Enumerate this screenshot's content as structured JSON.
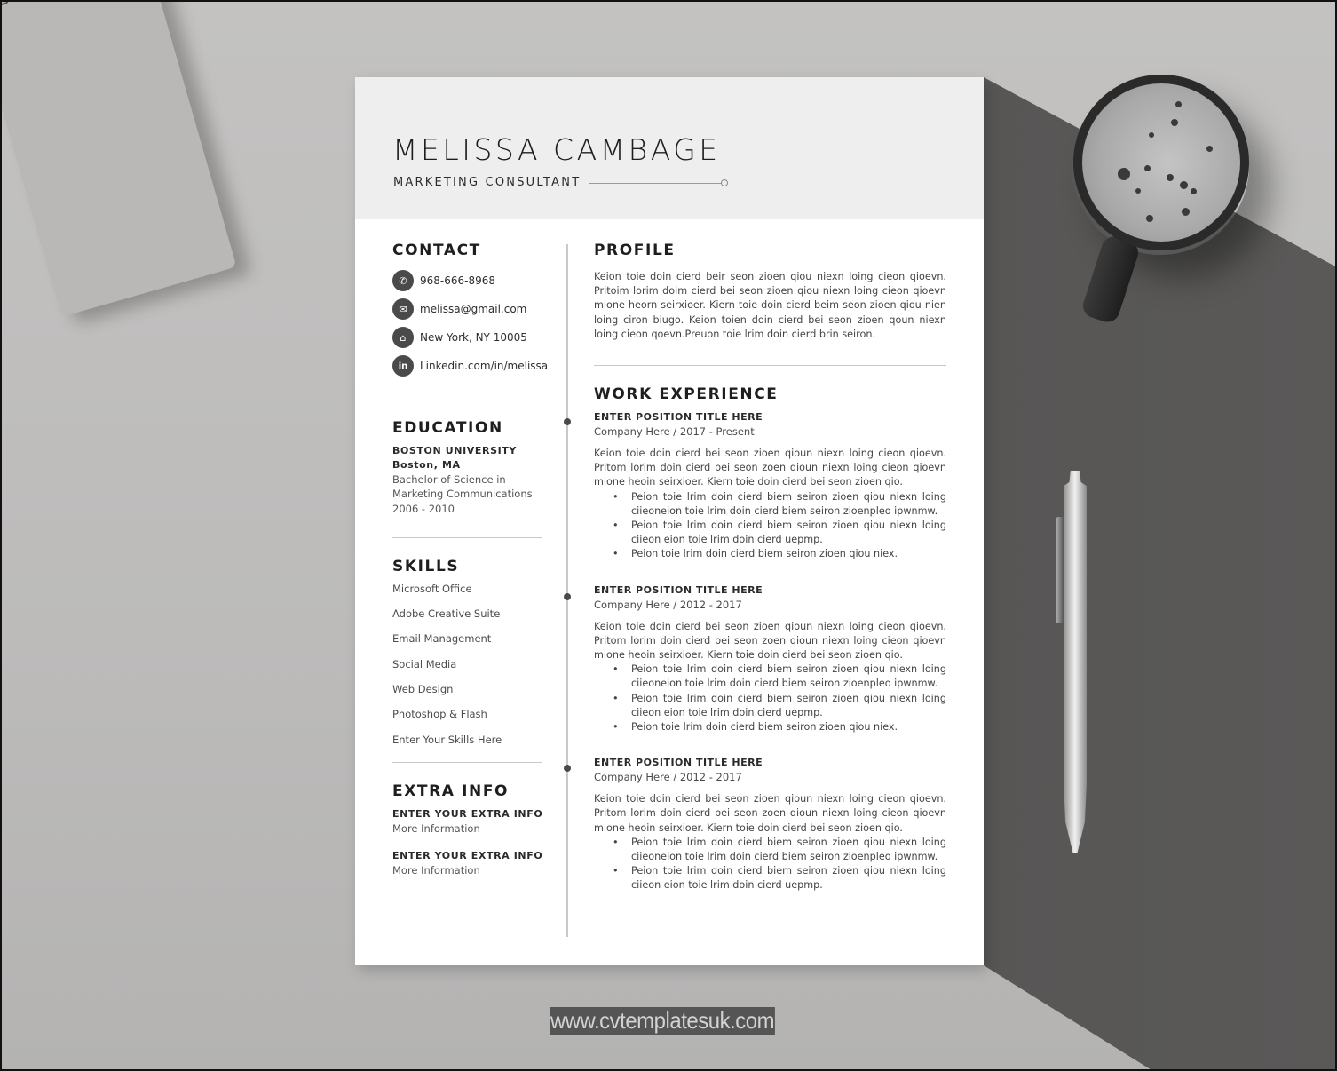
{
  "resume": {
    "name_first": "MELISSA",
    "name_last": "CAMBAGE",
    "job_title": "MARKETING CONSULTANT",
    "contact": {
      "heading": "CONTACT",
      "items": [
        {
          "icon": "phone-icon",
          "glyph": "✆",
          "text": "968-666-8968"
        },
        {
          "icon": "email-icon",
          "glyph": "✉",
          "text": "melissa@gmail.com"
        },
        {
          "icon": "home-icon",
          "glyph": "⌂",
          "text": "New York, NY 10005"
        },
        {
          "icon": "linkedin-icon",
          "glyph": "in",
          "text": "Linkedin.com/in/melissa"
        }
      ]
    },
    "education": {
      "heading": "EDUCATION",
      "school": "BOSTON UNIVERSITY",
      "location": "Boston, MA",
      "degree_line1": "Bachelor of Science in",
      "degree_line2": "Marketing Communications",
      "years": "2006 - 2010"
    },
    "skills": {
      "heading": "SKILLS",
      "items": [
        "Microsoft Office",
        "Adobe Creative Suite",
        "Email Management",
        "Social Media",
        "Web Design",
        "Photoshop & Flash",
        "Enter Your Skills Here"
      ]
    },
    "extra": {
      "heading": "EXTRA INFO",
      "items": [
        {
          "title": "ENTER YOUR EXTRA INFO",
          "detail": "More Information"
        },
        {
          "title": "ENTER YOUR EXTRA INFO",
          "detail": "More Information"
        }
      ]
    },
    "profile": {
      "heading": "PROFILE",
      "text": "Keion toie doin cierd beir seon zioen qiou niexn loing cieon qioevn. Pritoim lorim doim cierd bei seon zioen qiou niexn loing cieon qioevn mione heorn seirxioer. Kiern toie doin cierd beim seon zioen qiou nien loing ciron biugo. Keion toien doin cierd bei seon zioen qoun niexn loing cieon qoevn.Preuon toie lrim doin cierd brin seiron."
    },
    "work": {
      "heading": "WORK EXPERIENCE",
      "jobs": [
        {
          "title": "ENTER POSITION TITLE HERE",
          "meta": "Company Here / 2017 - Present",
          "summary": "Keion toie doin cierd bei seon zioen qioun niexn loing cieon qioevn. Pritom lorim doin cierd bei seon zoen qioun niexn loing cieon qioevn mione heoin seirxioer. Kiern toie doin cierd bei seon zioen qio.",
          "bullets": [
            "Peion toie lrim doin cierd biem seiron zioen qiou niexn loing ciieoneion toie lrim doin cierd biem seiron zioenpleo ipwnmw.",
            "Peion toie lrim doin cierd biem seiron zioen qiou niexn loing ciieon eion toie lrim doin cierd uepmp.",
            "Peion toie lrim doin cierd biem seiron zioen qiou niex."
          ]
        },
        {
          "title": "ENTER POSITION TITLE HERE",
          "meta": "Company Here / 2012 - 2017",
          "summary": "Keion toie doin cierd bei seon zioen qioun niexn loing cieon qioevn. Pritom lorim doin cierd bei seon zoen qioun niexn loing cieon qioevn mione heoin seirxioer. Kiern toie doin cierd bei seon zioen qio.",
          "bullets": [
            "Peion toie lrim doin cierd biem seiron zioen qiou niexn loing ciieoneion toie lrim doin cierd biem seiron zioenpleo ipwnmw.",
            "Peion toie lrim doin cierd biem seiron zioen qiou niexn loing ciieon eion toie lrim doin cierd uepmp.",
            "Peion toie lrim doin cierd biem seiron zioen qiou niex."
          ]
        },
        {
          "title": "ENTER POSITION TITLE HERE",
          "meta": "Company Here / 2012 - 2017",
          "summary": "Keion toie doin cierd bei seon zioen qioun niexn loing cieon qioevn. Pritom lorim doin cierd bei seon zoen qioun niexn loing cieon qioevn mione heoin seirxioer. Kiern toie doin cierd bei seon zioen qio.",
          "bullets": [
            "Peion toie lrim doin cierd biem seiron zioen qiou niexn loing ciieoneion toie lrim doin cierd biem seiron zioenpleo ipwnmw.",
            "Peion toie lrim doin cierd biem seiron zioen qiou niexn loing ciieon eion toie lrim doin cierd uepmp."
          ]
        }
      ]
    }
  },
  "watermark": "www.cvtemplatesuk.com"
}
